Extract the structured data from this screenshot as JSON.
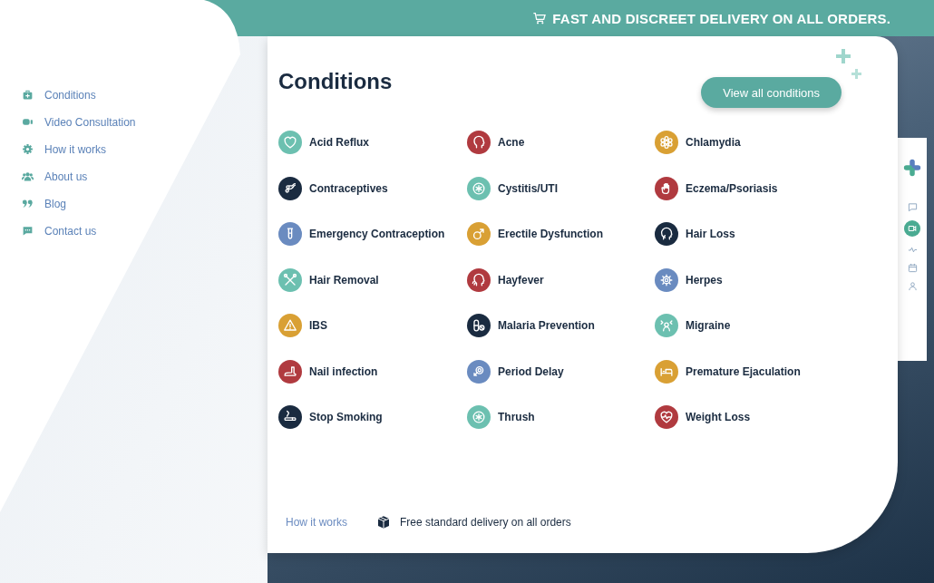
{
  "top_bar": {
    "text": "FAST AND DISCREET DELIVERY ON ALL ORDERS."
  },
  "sidebar": {
    "items": [
      {
        "label": "Conditions"
      },
      {
        "label": "Video Consultation"
      },
      {
        "label": "How it works"
      },
      {
        "label": "About us"
      },
      {
        "label": "Blog"
      },
      {
        "label": "Contact us"
      }
    ]
  },
  "conditions": {
    "title": "Conditions",
    "button": "View all conditions",
    "items": [
      {
        "label": "Acid Reflux",
        "color": "#6cc0b0"
      },
      {
        "label": "Acne",
        "color": "#b03a3f"
      },
      {
        "label": "Chlamydia",
        "color": "#d9a034"
      },
      {
        "label": "Contraceptives",
        "color": "#1a2b40"
      },
      {
        "label": "Cystitis/UTI",
        "color": "#6cc0b0"
      },
      {
        "label": "Eczema/Psoriasis",
        "color": "#b03a3f"
      },
      {
        "label": "Emergency Contraception",
        "color": "#6a8bc0"
      },
      {
        "label": "Erectile Dysfunction",
        "color": "#d9a034"
      },
      {
        "label": "Hair Loss",
        "color": "#1a2b40"
      },
      {
        "label": "Hair Removal",
        "color": "#6cc0b0"
      },
      {
        "label": "Hayfever",
        "color": "#b03a3f"
      },
      {
        "label": "Herpes",
        "color": "#6a8bc0"
      },
      {
        "label": "IBS",
        "color": "#d9a034"
      },
      {
        "label": "Malaria Prevention",
        "color": "#1a2b40"
      },
      {
        "label": "Migraine",
        "color": "#6cc0b0"
      },
      {
        "label": "Nail infection",
        "color": "#b03a3f"
      },
      {
        "label": "Period Delay",
        "color": "#6a8bc0"
      },
      {
        "label": "Premature Ejaculation",
        "color": "#d9a034"
      },
      {
        "label": "Stop Smoking",
        "color": "#1a2b40"
      },
      {
        "label": "Thrush",
        "color": "#6cc0b0"
      },
      {
        "label": "Weight Loss",
        "color": "#b03a3f"
      }
    ]
  },
  "footer": {
    "link": "How it works",
    "delivery": "Free standard delivery on all orders"
  }
}
